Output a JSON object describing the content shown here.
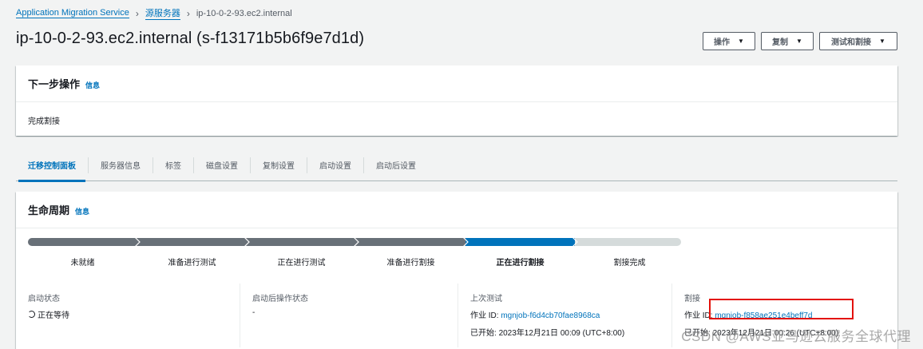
{
  "breadcrumb": {
    "items": [
      "Application Migration Service",
      "源服务器"
    ],
    "current": "ip-10-0-2-93.ec2.internal"
  },
  "page": {
    "title": "ip-10-0-2-93.ec2.internal (s-f13171b5b6f9e7d1d)"
  },
  "header_actions": {
    "actions_label": "操作",
    "replicate_label": "复制",
    "test_cutover_label": "测试和割接"
  },
  "next_step": {
    "title": "下一步操作",
    "info": "信息",
    "text": "完成割接"
  },
  "tabs": [
    {
      "label": "迁移控制面板",
      "active": true
    },
    {
      "label": "服务器信息",
      "active": false
    },
    {
      "label": "标签",
      "active": false
    },
    {
      "label": "磁盘设置",
      "active": false
    },
    {
      "label": "复制设置",
      "active": false
    },
    {
      "label": "启动设置",
      "active": false
    },
    {
      "label": "启动后设置",
      "active": false
    }
  ],
  "lifecycle": {
    "title": "生命周期",
    "info": "信息",
    "stages": [
      "未就绪",
      "准备进行测试",
      "正在进行测试",
      "准备进行割接",
      "正在进行割接",
      "割接完成"
    ],
    "current_stage_index": 4,
    "status": {
      "launch_status_label": "启动状态",
      "launch_status_value": "正在等待",
      "post_launch_label": "启动后操作状态",
      "post_launch_value": "-",
      "last_test_label": "上次测试",
      "last_test_job_prefix": "作业 ID:",
      "last_test_job_id": "mgnjob-f6d4cb70fae8968ca",
      "last_test_started_label": "已开始:",
      "last_test_started_value": "2023年12月21日 00:09 (UTC+8:00)",
      "cutover_label": "割接",
      "cutover_job_prefix": "作业 ID:",
      "cutover_job_id": "mgnjob-f858ae251e4beff7d",
      "cutover_started_label": "已开始:",
      "cutover_started_value": "2023年12月21日 00:26 (UTC+8:00)"
    }
  },
  "colors": {
    "link": "#0073bb",
    "progress_done": "#687078",
    "progress_active": "#0073bb",
    "progress_pending": "#d5dbdb",
    "highlight": "#e3110a"
  },
  "watermark": "CSDN @AWS亚马逊云服务全球代理"
}
